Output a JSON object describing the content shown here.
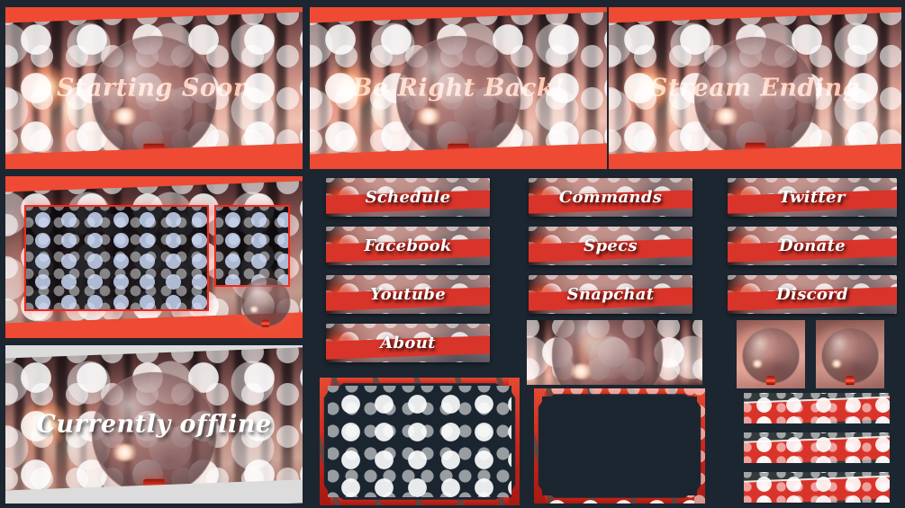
{
  "theme": {
    "background": "#1c2630",
    "accent_red": "#d9342a",
    "band_red": "#ef4a33",
    "title_color": "#ffb9a0",
    "offline_band": "#dcdcdc"
  },
  "screens": [
    {
      "name": "starting-soon",
      "title": "Starting Soon",
      "style": "peach"
    },
    {
      "name": "be-right-back",
      "title": "Be Right Back!",
      "style": "peach"
    },
    {
      "name": "stream-ending",
      "title": "Stream Ending",
      "style": "peach"
    }
  ],
  "offline_screen": {
    "title": "Currently offline",
    "style": "white"
  },
  "layout_overlay": {
    "name": "stream-layout-overlay",
    "main_screen_label": "",
    "side_screen_label": ""
  },
  "panel_buttons": {
    "column_1": [
      "Schedule",
      "Facebook",
      "Youtube",
      "About"
    ],
    "column_2": [
      "Commands",
      "Specs",
      "Snapchat"
    ],
    "column_3": [
      "Twitter",
      "Donate",
      "Discord"
    ]
  },
  "webcam_frames": [
    {
      "name": "webcam-frame-starry"
    },
    {
      "name": "webcam-frame-plain"
    }
  ],
  "banner_image": {
    "name": "crystal-ball-banner"
  },
  "avatars": [
    {
      "name": "crystal-ball-avatar-1"
    },
    {
      "name": "crystal-ball-avatar-2"
    }
  ],
  "strip_banners": [
    {
      "name": "strip-banner-1"
    },
    {
      "name": "strip-banner-2"
    },
    {
      "name": "strip-banner-3"
    }
  ]
}
